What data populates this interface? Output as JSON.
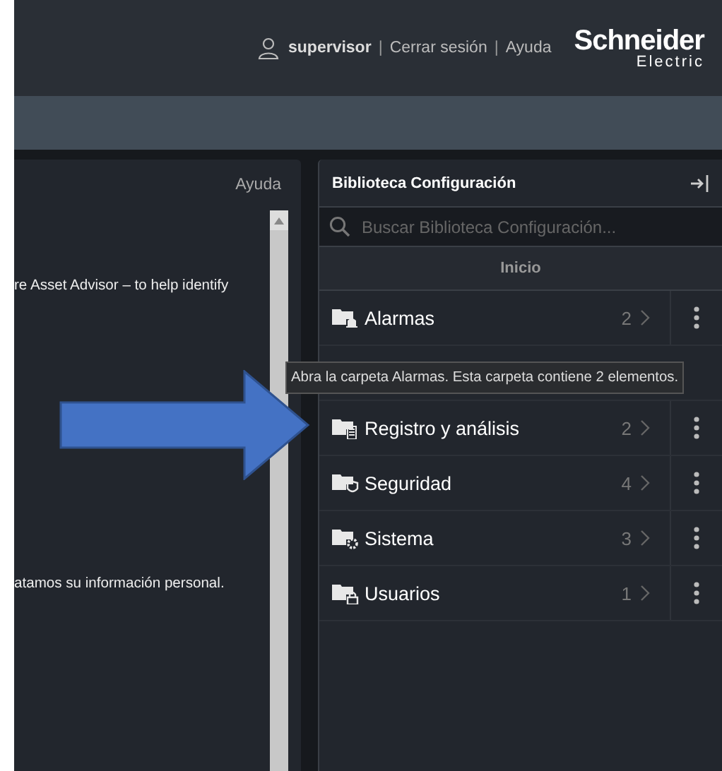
{
  "header": {
    "user": "supervisor",
    "separator": "|",
    "links": [
      "Cerrar sesión",
      "Ayuda"
    ],
    "logo": {
      "name": "Schneider",
      "sub": "Electric"
    }
  },
  "left_panel": {
    "help": "Ayuda",
    "paragraphs": [
      "re Asset Advisor – to help identify",
      "atamos su información personal."
    ]
  },
  "library": {
    "title": "Biblioteca Configuración",
    "search": {
      "placeholder": "Buscar Biblioteca Configuración..."
    },
    "breadcrumb": "Inicio",
    "items": [
      {
        "kind": "folder",
        "name": "Alarmas",
        "count": "2"
      },
      {
        "kind": "covered"
      },
      {
        "kind": "folder",
        "name": "Registro y análisis",
        "count": "2"
      },
      {
        "kind": "folder",
        "name": "Seguridad",
        "count": "4"
      },
      {
        "kind": "folder",
        "name": "Sistema",
        "count": "3"
      },
      {
        "kind": "folder",
        "name": "Usuarios",
        "count": "1"
      }
    ]
  },
  "tooltip": "Abra la carpeta Alarmas. Esta carpeta contiene 2 elementos."
}
